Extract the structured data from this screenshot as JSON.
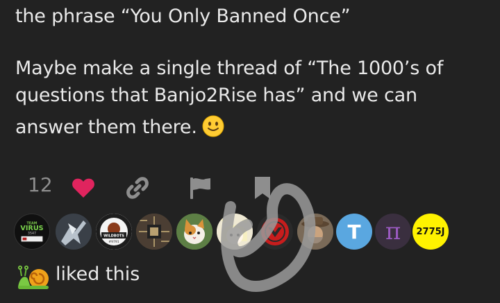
{
  "post": {
    "line1": "the phrase “You Only Banned Once”",
    "line2": "Maybe make a single thread of “The 1000’s of",
    "line3": "questions that Banjo2Rise has” and we can",
    "line4": "answer them there."
  },
  "emoji": "slightly-smiling-face",
  "actions": {
    "like_count": "12",
    "icons": [
      "heart-icon",
      "link-icon",
      "flag-icon",
      "bookmark-icon"
    ],
    "heart_color": "#e0245e"
  },
  "avatars": [
    {
      "name": "avatar-team-virus",
      "top": "TEAM",
      "label": "VIRUS",
      "num": "3547"
    },
    {
      "name": "avatar-metal-figure"
    },
    {
      "name": "avatar-wildbots",
      "label": "WILDBOTS",
      "num": "#9791"
    },
    {
      "name": "avatar-circuit-board"
    },
    {
      "name": "avatar-cat"
    },
    {
      "name": "avatar-anime-character"
    },
    {
      "name": "avatar-red-logo"
    },
    {
      "name": "avatar-person-hat"
    },
    {
      "name": "avatar-letter-t",
      "label": "T"
    },
    {
      "name": "avatar-pi",
      "label": "π"
    },
    {
      "name": "avatar-2775j",
      "label": "2775J"
    }
  ],
  "liked": {
    "text": "liked this"
  },
  "colors": {
    "background": "#222222",
    "text": "#eaeaea",
    "muted": "#8e8e8e",
    "t_avatar": "#5aa7e0",
    "pi_avatar": "#3a2f3f",
    "badge_yellow": "#fff200"
  }
}
